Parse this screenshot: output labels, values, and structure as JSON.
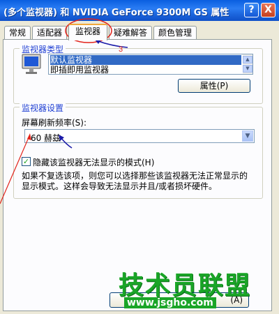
{
  "window": {
    "title": "(多个监视器) 和 NVIDIA GeForce 9300M GS 属性",
    "help_label": "?",
    "close_label": "X"
  },
  "tabs": [
    {
      "label": "常规"
    },
    {
      "label": "适配器"
    },
    {
      "label": "监视器",
      "active": true
    },
    {
      "label": "疑难解答"
    },
    {
      "label": "颜色管理"
    }
  ],
  "monitor_type": {
    "group_label": "监视器类型",
    "items": [
      {
        "label": "默认监视器",
        "selected": true
      },
      {
        "label": "即插即用监视器",
        "selected": false
      }
    ],
    "properties_button": "属性(P)"
  },
  "monitor_settings": {
    "group_label": "监视器设置",
    "refresh_label": "屏幕刷新频率(S):",
    "refresh_value": "60 赫兹",
    "hide_modes_label": "隐藏该监视器无法显示的模式(H)",
    "hide_modes_checked": true,
    "description": "如果不复选该项，则您可以选择那些该监视器无法正常显示的显示模式。这样会导致无法显示并且/或者损坏硬件。"
  },
  "footer": {
    "apply_suffix": "(A)"
  },
  "annotation": {
    "step_number": "3",
    "color": "#e2231a",
    "arrow_color": "#1a1aa8"
  },
  "watermark": {
    "brand": "技术员联盟",
    "url": "www.jsgho.com",
    "color": "#1aa527"
  }
}
